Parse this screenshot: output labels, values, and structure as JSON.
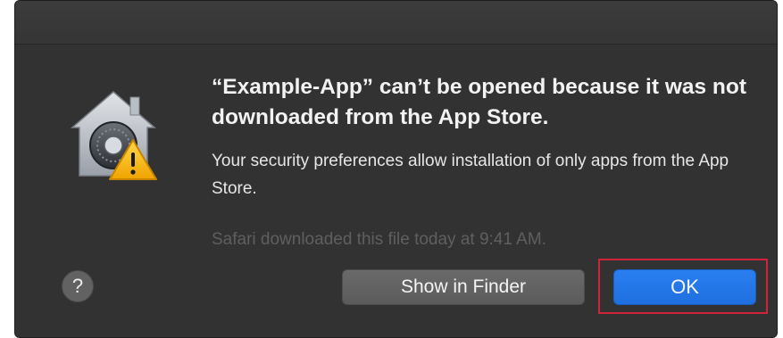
{
  "dialog": {
    "icon": "gatekeeper-security-icon",
    "headline": "“Example-App” can’t be opened because it was not downloaded from the App Store.",
    "body": "Your security preferences allow installation of only apps from the App Store.",
    "info": "Safari downloaded this file today at 9:41 AM.",
    "help_label": "?",
    "secondary_button_label": "Show in Finder",
    "primary_button_label": "OK"
  },
  "colors": {
    "dialog_background": "#323232",
    "primary_button": "#2a7ff0",
    "highlight_box": "#d0243a"
  }
}
